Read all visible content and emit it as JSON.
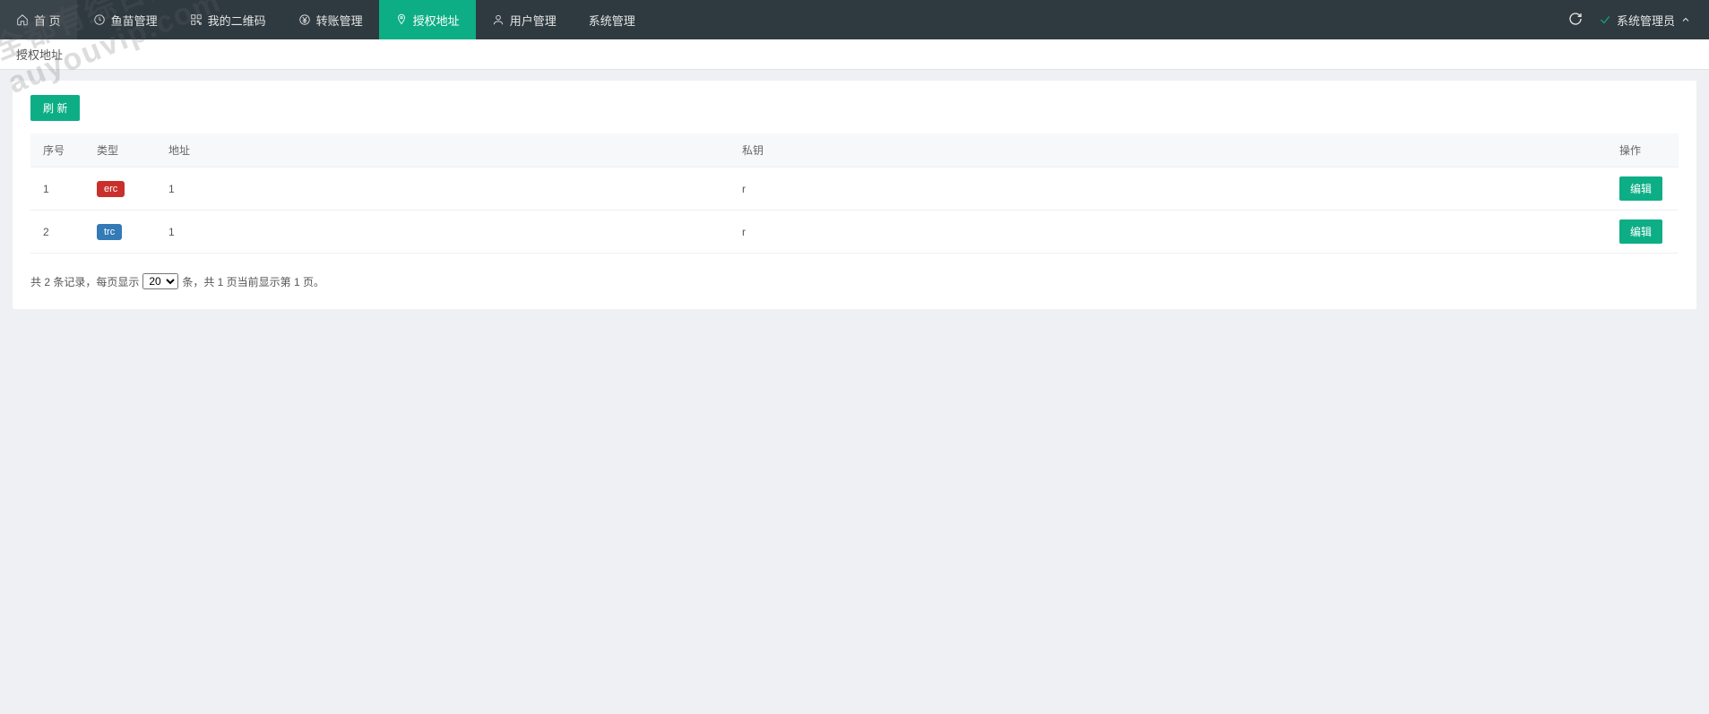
{
  "watermark": "全都有综合资源网\nauyouvip.com",
  "nav": {
    "items": [
      {
        "icon": "home",
        "label": "首 页"
      },
      {
        "icon": "clock",
        "label": "鱼苗管理"
      },
      {
        "icon": "qrcode",
        "label": "我的二维码"
      },
      {
        "icon": "yen",
        "label": "转账管理"
      },
      {
        "icon": "pin",
        "label": "授权地址",
        "active": true
      },
      {
        "icon": "user",
        "label": "用户管理"
      },
      {
        "icon": "",
        "label": "系统管理"
      }
    ],
    "user_label": "系统管理员"
  },
  "crumb": "授权地址",
  "buttons": {
    "refresh": "刷 新",
    "edit": "编辑"
  },
  "table": {
    "headers": {
      "seq": "序号",
      "type": "类型",
      "addr": "地址",
      "key": "私钥",
      "act": "操作"
    },
    "rows": [
      {
        "seq": "1",
        "type": "erc",
        "type_class": "erc",
        "addr": "1",
        "key": "r"
      },
      {
        "seq": "2",
        "type": "trc",
        "type_class": "trc",
        "addr": "1",
        "key": "r"
      }
    ]
  },
  "pager": {
    "prefix": "共 2 条记录，每页显示",
    "select_value": "20",
    "suffix": "条，共 1 页当前显示第 1 页。"
  }
}
